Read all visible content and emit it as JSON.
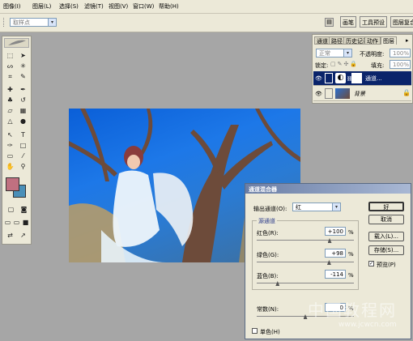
{
  "menu": [
    "图像(I)",
    "图层(L)",
    "选择(S)",
    "滤镜(T)",
    "视图(V)",
    "窗口(W)",
    "帮助(H)"
  ],
  "options_bar": {
    "style_combo": "取样点",
    "well_tabs": [
      "画笔",
      "工具预设",
      "图层复合"
    ]
  },
  "layers_panel": {
    "tabs": [
      "通道",
      "路径",
      "历史记录",
      "动作",
      "图层"
    ],
    "blend_mode": "正常",
    "opacity_label": "不透明度:",
    "opacity_value": "100%",
    "lock_label": "锁定:",
    "fill_label": "填充:",
    "fill_value": "100%",
    "layers": [
      {
        "name": "通道..."
      },
      {
        "name": "背景"
      }
    ]
  },
  "dialog": {
    "title": "通道混合器",
    "output_channel_label": "输出通道(O):",
    "output_channel_value": "红",
    "source_group_label": "源通道",
    "sliders": [
      {
        "label": "红色(R):",
        "value": "+100",
        "unit": "%",
        "level": 100
      },
      {
        "label": "绿色(G):",
        "value": "+98",
        "unit": "%",
        "level": 98
      },
      {
        "label": "蓝色(B):",
        "value": "-114",
        "unit": "%",
        "level": -114
      }
    ],
    "constant": {
      "label": "常数(N):",
      "value": "0",
      "unit": "%",
      "level": 0
    },
    "buttons": [
      "好",
      "取消",
      "载入(L)...",
      "存储(S)..."
    ],
    "preview_label": "预览(P)",
    "preview_checked": true,
    "mono_label": "单色(H)",
    "mono_checked": false
  },
  "watermark": {
    "text": "中国教程网",
    "url": "www.jcwcn.com"
  },
  "colors": {
    "foreground": "#c07080",
    "background": "#4a8fb8",
    "accent": "#6a7ea6"
  }
}
